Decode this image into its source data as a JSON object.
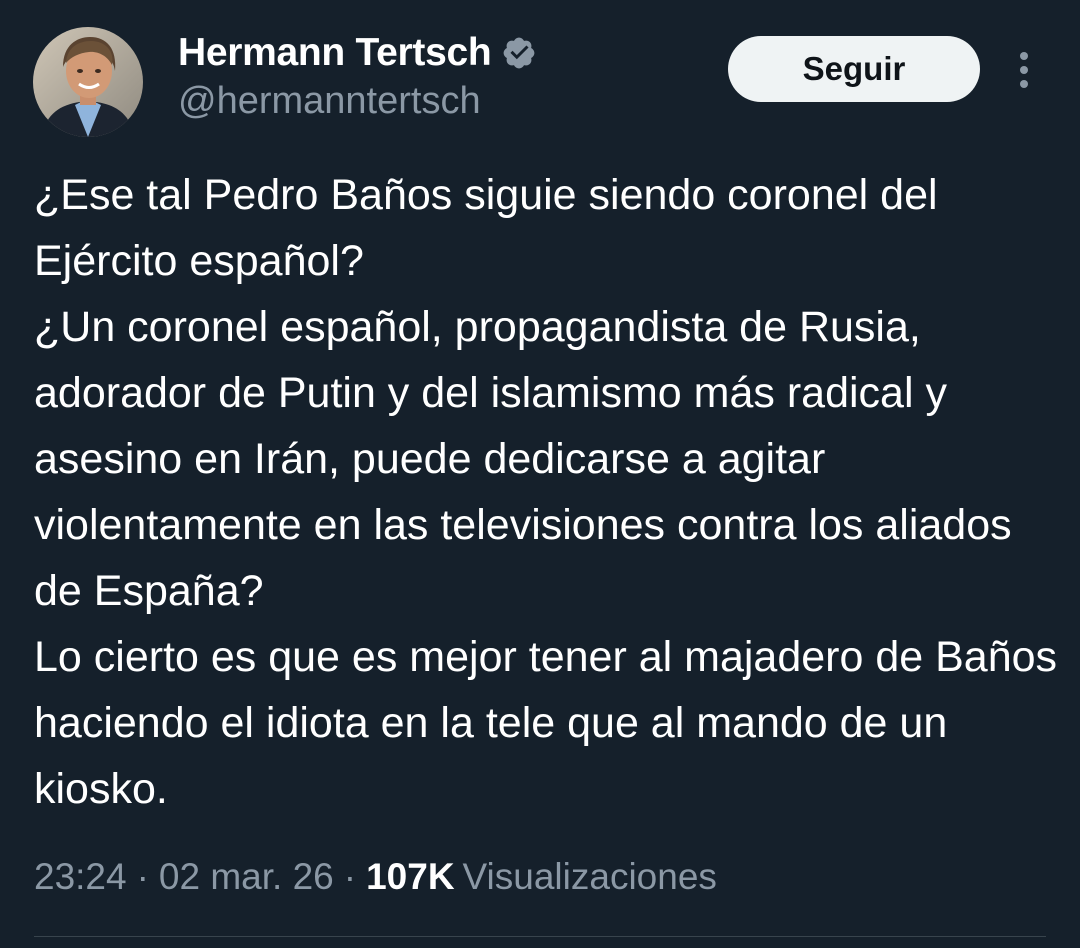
{
  "author": {
    "display_name": "Hermann Tertsch",
    "handle": "@hermanntertsch",
    "verified": true,
    "verified_color": "#8b98a5",
    "avatar_icon": "profile-photo"
  },
  "actions": {
    "follow_label": "Seguir",
    "more_icon": "more-vertical-icon"
  },
  "tweet": {
    "text": "¿Ese tal Pedro Baños siguie siendo coronel del Ejército español?\n¿Un coronel español, propagandista de Rusia, adorador de Putin y del islamismo más radical y asesino en Irán, puede dedicarse a agitar violentamente en las televisiones contra los aliados de España?\nLo cierto es que es mejor tener al majadero de Baños haciendo el idiota en la tele que al mando de un kiosko."
  },
  "meta": {
    "time": "23:24",
    "separator": "·",
    "date": "02 mar. 26",
    "views_count": "107K",
    "views_label": "Visualizaciones"
  },
  "colors": {
    "background": "#15202b",
    "text_primary": "#ffffff",
    "text_secondary": "#8b98a5",
    "button_bg": "#eff3f4",
    "button_text": "#0f1419",
    "divider": "#38444d"
  }
}
